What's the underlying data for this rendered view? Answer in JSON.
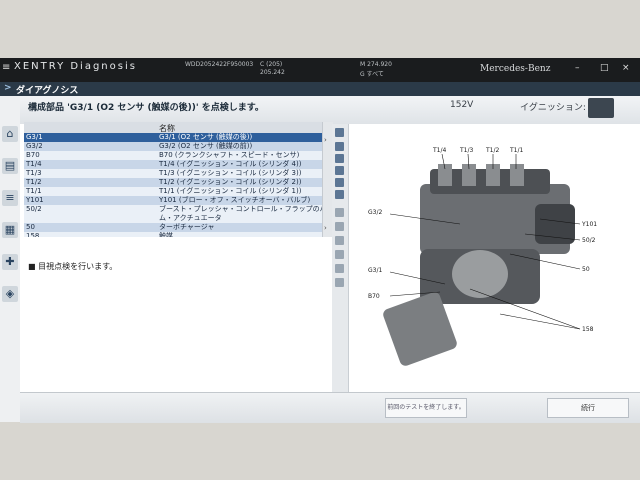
{
  "app": {
    "name": "XENTRY Diagnosis",
    "menu_glyph": "≡",
    "vin": "WDD2052422F950003",
    "code1": "C (205)",
    "code2": "205.242",
    "code3": "M 274.920",
    "code4": "G すべて",
    "brand": "Mercedes-Benz",
    "win_min": "–",
    "win_max": "□",
    "win_close": "×"
  },
  "nav": {
    "title": "ダイアグノシス",
    "back_glyph": ">"
  },
  "header": {
    "instruction": "構成部品 'G3/1 (O2 センサ (触媒の後))' を点検します。",
    "voltage": "152V",
    "ignition": "イグニッション: オン"
  },
  "table": {
    "col_header": "名称",
    "rows": [
      {
        "code": "G3/1",
        "name": "G3/1 (O2 センサ (触媒の後))"
      },
      {
        "code": "G3/2",
        "name": "G3/2 (O2 センサ (触媒の前))"
      },
      {
        "code": "B70",
        "name": "B70 (クランクシャフト・スピード・センサ)"
      },
      {
        "code": "T1/4",
        "name": "T1/4 (イグニッション・コイル (シリンダ 4))"
      },
      {
        "code": "T1/3",
        "name": "T1/3 (イグニッション・コイル (シリンダ 3))"
      },
      {
        "code": "T1/2",
        "name": "T1/2 (イグニッション・コイル (シリンダ 2))"
      },
      {
        "code": "T1/1",
        "name": "T1/1 (イグニッション・コイル (シリンダ 1))"
      },
      {
        "code": "Y101",
        "name": "Y101 (ブロー・オフ・スイッチオーバ・バルブ)"
      },
      {
        "code": "50/2",
        "name": "ブースト・プレッシャ・コントロール・フラップのバキュー"
      },
      {
        "code": "",
        "name": "ム・アクチュエータ"
      },
      {
        "code": "50",
        "name": "ターボチャージャ"
      },
      {
        "code": "158",
        "name": "触媒"
      }
    ]
  },
  "message": "■ 目視点検を行います。",
  "diagram": {
    "labels": {
      "t14": "T1/4",
      "t13": "T1/3",
      "t12": "T1/2",
      "t11": "T1/1",
      "g32": "G3/2",
      "y101": "Y101",
      "c502": "50/2",
      "g31": "G3/1",
      "c50": "50",
      "b70": "B70",
      "c158": "158"
    }
  },
  "footer": {
    "center_button": "前回のテストを終了します。",
    "right_button": "続行"
  }
}
